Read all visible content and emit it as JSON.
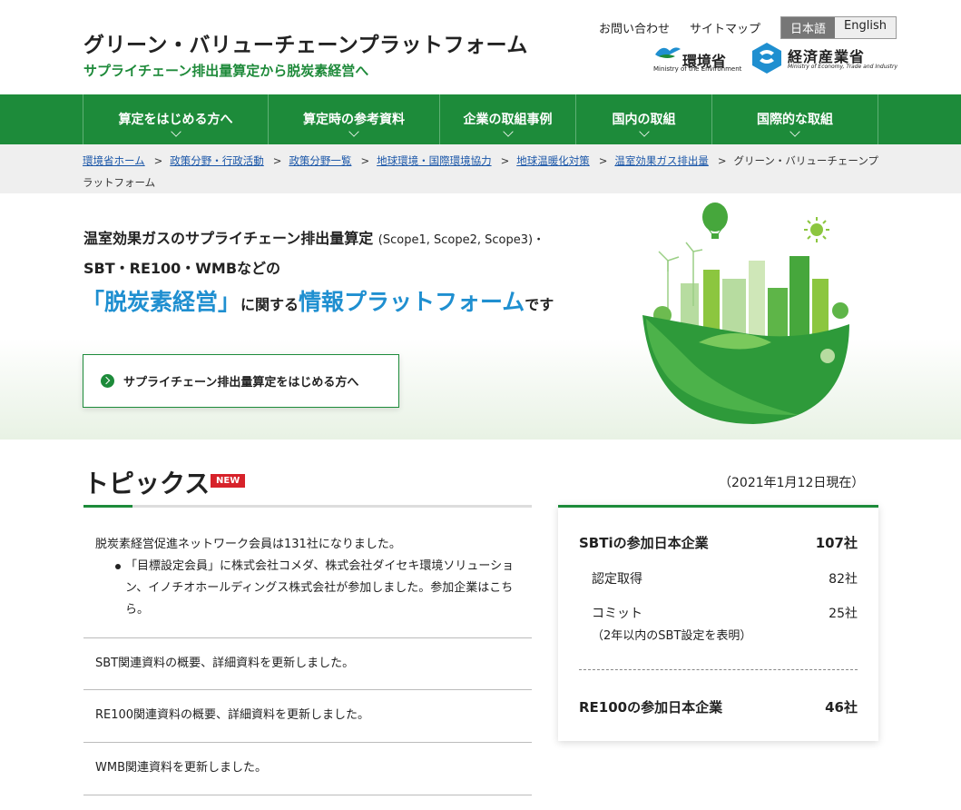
{
  "header": {
    "site_title": "グリーン・バリューチェーンプラットフォーム",
    "site_subtitle": "サプライチェーン排出量算定から脱炭素経営へ",
    "utility_links": [
      "お問い合わせ",
      "サイトマップ"
    ],
    "languages": {
      "ja": "日本語",
      "en": "English",
      "selected": "日本語"
    },
    "logo_env": {
      "jp": "環境省",
      "en": "Ministry of the Environment"
    },
    "logo_meti": {
      "jp": "経済産業省",
      "en": "Ministry of Economy, Trade and Industry"
    }
  },
  "nav": [
    "算定をはじめる方へ",
    "算定時の参考資料",
    "企業の取組事例",
    "国内の取組",
    "国際的な取組"
  ],
  "breadcrumb": {
    "links": [
      "環境省ホーム",
      "政策分野・行政活動",
      "政策分野一覧",
      "地球環境・国際環境協力",
      "地球温暖化対策",
      "温室効果ガス排出量"
    ],
    "current": "グリーン・バリューチェーンプラットフォーム"
  },
  "hero": {
    "line1": "温室効果ガスのサプライチェーン排出量算定",
    "line1_small": "(Scope1, Scope2, Scope3)・",
    "line2": "SBT・RE100・WMBなどの",
    "line3_a": "「脱炭素経営」",
    "line3_b": "に関する",
    "line3_c": "情報プラットフォーム",
    "line3_d": "です",
    "cta": "サプライチェーン排出量算定をはじめる方へ"
  },
  "topics": {
    "title": "トピックス",
    "badge": "NEW",
    "items": [
      {
        "text": "脱炭素経営促進ネットワーク会員は131社になりました。",
        "bullet": "「目標設定会員」に株式会社コメダ、株式会社ダイセキ環境ソリューション、イノチオホールディングス株式会社が参加しました。参加企業はこちら。"
      },
      {
        "text": "SBT関連資料の概要、詳細資料を更新しました。"
      },
      {
        "text": "RE100関連資料の概要、詳細資料を更新しました。"
      },
      {
        "text": "WMB関連資料を更新しました。"
      }
    ]
  },
  "stats": {
    "as_of": "（2021年1月12日現在）",
    "sbti_label": "SBTiの参加日本企業",
    "sbti_value": "107社",
    "certified_label": "認定取得",
    "certified_value": "82社",
    "commit_label": "コミット",
    "commit_value": "25社",
    "commit_note": "（2年以内のSBT設定を表明）",
    "re100_label": "RE100の参加日本企業",
    "re100_value": "46社"
  },
  "colors": {
    "brand_green": "#1d8b3a",
    "accent_blue": "#1f8fd0",
    "badge_red": "#d7222a"
  }
}
